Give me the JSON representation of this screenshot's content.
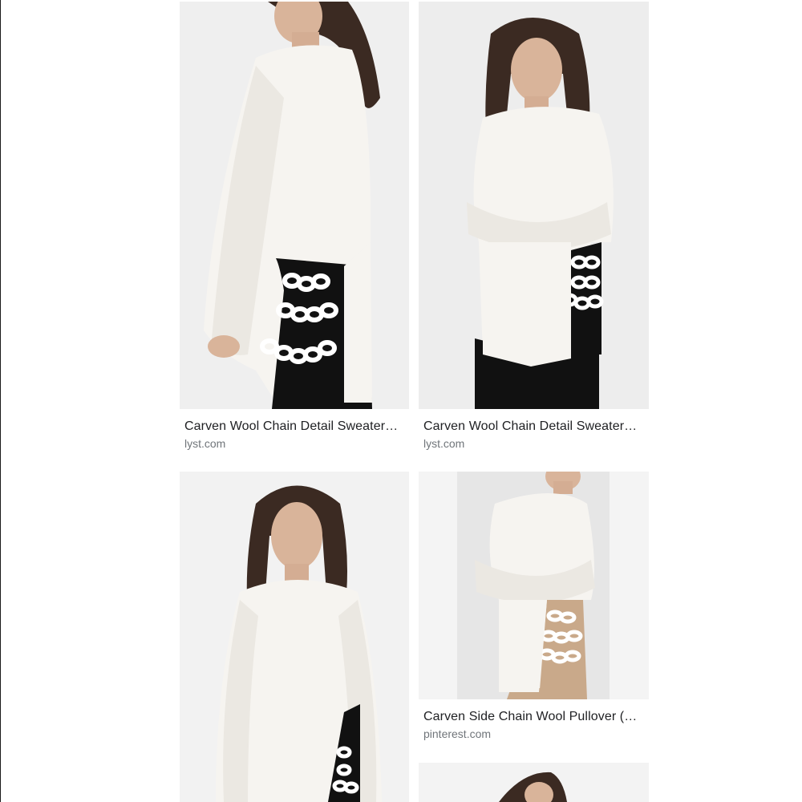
{
  "results": [
    {
      "title": "Carven Wool Chain Detail Sweater…",
      "source": "lyst.com",
      "image": "model-white-sweater-side-profile"
    },
    {
      "title": "Carven Wool Chain Detail Sweater…",
      "source": "lyst.com",
      "image": "model-white-sweater-arms-crossed"
    },
    {
      "title": "",
      "source": "",
      "image": "model-white-sweater-front"
    },
    {
      "title": "Carven Side Chain Wool Pullover (…",
      "source": "pinterest.com",
      "image": "model-white-pullover-arms-folded"
    },
    {
      "title": "",
      "source": "",
      "image": "model-partial-cropped"
    }
  ],
  "colors": {
    "sweater": "#f4f2ee",
    "background": "#ededed",
    "hair": "#3b2a22",
    "skin": "#d9b49a",
    "pants": "#111111",
    "chain": "#ffffff",
    "camel": "#c9a98a"
  }
}
